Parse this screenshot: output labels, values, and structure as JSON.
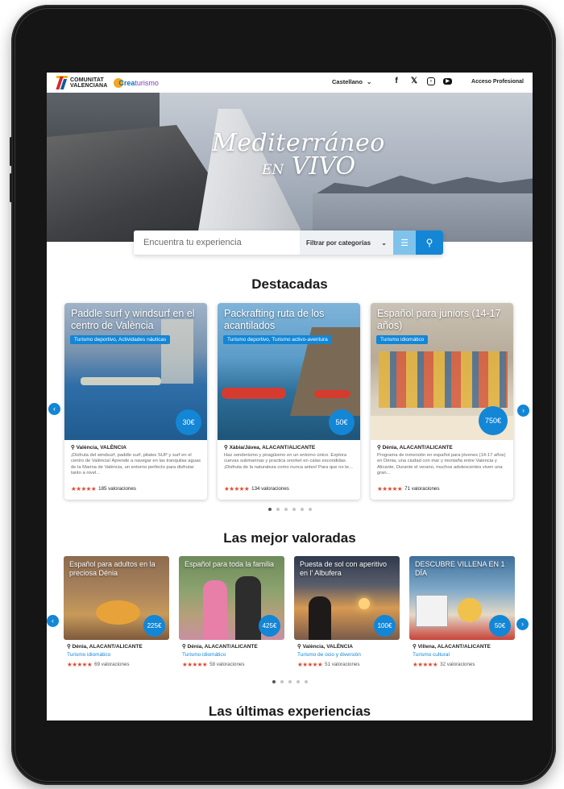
{
  "header": {
    "logo_comunitat": "COMUNITAT",
    "logo_valenciana": "VALENCIANA",
    "logo_crea_a": "Crea",
    "logo_crea_b": "turismo",
    "language": "Castellano",
    "access": "Acceso Profesional"
  },
  "hero": {
    "title_line1": "Mediterráneo",
    "title_line2_a": "EN",
    "title_line2_b": "VIVO"
  },
  "search": {
    "placeholder": "Encuentra tu experiencia",
    "filter_label": "Filtrar por categorías"
  },
  "featured": {
    "title": "Destacadas",
    "cards": [
      {
        "title": "Paddle surf y windsurf en el centro de València",
        "badge": "Turismo deportivo, Actividades náuticas",
        "price": "30€",
        "location": "València, VALÈNCIA",
        "description": "¡Disfruta del windsurf, paddle surf, pilates SUP y surf en el centro de València! Aprende a navegar en las tranquilas aguas de la Marina de València, un entorno perfecto para disfrutar tanto a nivel...",
        "ratings": "185 valoraciones"
      },
      {
        "title": "Packrafting ruta de los acantilados",
        "badge": "Turismo deportivo, Turismo activo-aventura",
        "price": "50€",
        "location": "Xàbia/Jávea, ALACANT/ALICANTE",
        "description": "Haz senderismo y piragüismo en un entorno único. Explora cuevas submarinas y practica snorkel en calas escondidas. ¡Disfruta de la naturaleza como nunca antes! Para que no te...",
        "ratings": "134 valoraciones"
      },
      {
        "title": "Español para juniors (14-17 años)",
        "badge": "Turismo idiomático",
        "price": "750€",
        "location": "Dénia, ALACANT/ALICANTE",
        "description": "Programa de inmersión en español para jóvenes (14-17 años) en Dénia, una ciudad con mar y montaña entre Valencia y Alicante. Durante el verano, muchos adolescentes viven una gran...",
        "ratings": "71 valoraciones"
      }
    ]
  },
  "best_rated": {
    "title": "Las mejor valoradas",
    "cards": [
      {
        "title": "Español para adultos en la preciosa Dénia",
        "price": "225€",
        "location": "Dénia, ALACANT/ALICANTE",
        "category": "Turismo idiomático",
        "ratings": "69 valoraciones"
      },
      {
        "title": "Español para toda la familia",
        "price": "425€",
        "location": "Dénia, ALACANT/ALICANTE",
        "category": "Turismo idiomático",
        "ratings": "58 valoraciones"
      },
      {
        "title": "Puesta de sol con aperitivo en l' Albufera",
        "price": "100€",
        "location": "València, VALÈNCIA",
        "category": "Turismo de ocio y diversión",
        "ratings": "51 valoraciones"
      },
      {
        "title": "DESCUBRE VILLENA EN 1 DÍA",
        "price": "50€",
        "location": "Villena, ALACANT/ALICANTE",
        "category": "Turismo cultural",
        "ratings": "32 valoraciones"
      }
    ]
  },
  "latest": {
    "title": "Las últimas experiencias"
  },
  "icons": {
    "stars": "★★★★★",
    "pin": "⚲"
  },
  "colors": {
    "accent": "#1386d6",
    "accent_light": "#7fc3ec",
    "stars": "#e5472e"
  }
}
